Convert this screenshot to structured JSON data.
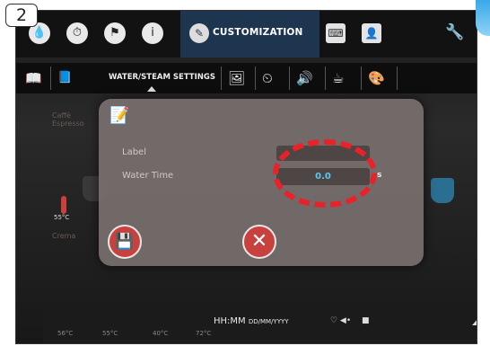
{
  "step": "2",
  "topbar": {
    "icons": [
      "water-drop-icon",
      "clock-icon",
      "flag-icon",
      "info-icon"
    ],
    "active_tab": "CUSTOMIZATION",
    "right_icons": [
      "keyboard-icon",
      "user-icon"
    ],
    "settings_icon": "wrench-icon"
  },
  "subbar": {
    "label": "WATER/STEAM SETTINGS",
    "icons": [
      "book-icon",
      "book-open-icon",
      "picture-icon",
      "timer-icon",
      "speaker-icon",
      "cup-icon",
      "palette-icon"
    ]
  },
  "background": {
    "menu_caption": "Caffè\nEspresso",
    "crema_caption": "Crema",
    "left_temp": "55°C"
  },
  "dialog": {
    "label_row": "Label",
    "label_value": "",
    "water_time_row": "Water Time",
    "water_time_value": "0.0",
    "unit": "s"
  },
  "bottombar": {
    "time": "HH:MM",
    "date": "DD/MM/YYYY",
    "temps": [
      "56°C",
      "55°C",
      "40°C",
      "72°C"
    ]
  },
  "colors": {
    "accent_red": "#ea2128",
    "button_red": "#c8413f",
    "value_blue": "#5cc4f0",
    "active_tab_bg": "#1e3550"
  }
}
